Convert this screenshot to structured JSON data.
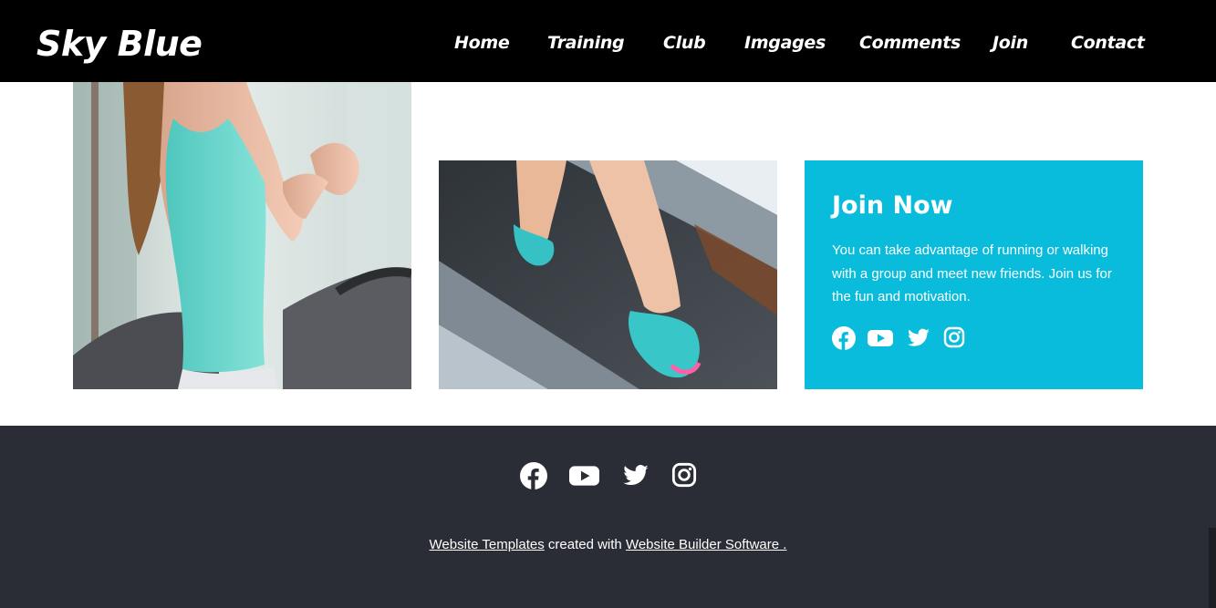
{
  "brand": {
    "name": "Sky Blue"
  },
  "nav": {
    "items": [
      {
        "label": "Home"
      },
      {
        "label": "Training"
      },
      {
        "label": "Club"
      },
      {
        "label": "Imgages"
      },
      {
        "label": "Comments"
      },
      {
        "label": "Join"
      },
      {
        "label": "Contact"
      }
    ]
  },
  "join_card": {
    "title": "Join Now",
    "text": "You can take advantage of running or walking with a group and meet new friends. Join us for the fun and motivation.",
    "background_color": "#09bcdb",
    "social_icons": [
      "facebook-icon",
      "youtube-icon",
      "twitter-icon",
      "instagram-icon"
    ]
  },
  "footer": {
    "background_color": "#2a2d35",
    "social_icons": [
      "facebook-icon",
      "youtube-icon",
      "twitter-icon",
      "instagram-icon"
    ],
    "credit": {
      "link1": "Website Templates",
      "middle": " created with ",
      "link2": "Website Builder Software ."
    }
  }
}
